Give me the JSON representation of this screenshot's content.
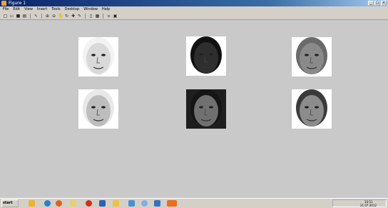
{
  "window": {
    "title": "Figure 1"
  },
  "menu": [
    "File",
    "Edit",
    "View",
    "Insert",
    "Tools",
    "Desktop",
    "Window",
    "Help"
  ],
  "toolbar": [
    "new-figure-icon",
    "open-icon",
    "save-icon",
    "print-icon",
    "pointer-icon",
    "zoom-in-icon",
    "zoom-out-icon",
    "pan-icon",
    "rotate-icon",
    "data-cursor-icon",
    "insert-colorbar-icon",
    "insert-legend-icon",
    "hide-plot-tools-icon",
    "show-plot-tools-icon"
  ],
  "taskbar": {
    "start_label": "start",
    "time": "10:51",
    "date": "21.07.2012"
  },
  "faces": [
    {
      "skin": "#d9d9d9",
      "hair": "#f2f2f2",
      "bg": "#ffffff"
    },
    {
      "skin": "#2e2e2e",
      "hair": "#111111",
      "bg": "#ffffff"
    },
    {
      "skin": "#8a8a8a",
      "hair": "#6a6a6a",
      "bg": "#ffffff"
    },
    {
      "skin": "#bdbdbd",
      "hair": "#e8e8e8",
      "bg": "#ffffff"
    },
    {
      "skin": "#707070",
      "hair": "#151515",
      "bg": "#1e1e1e"
    },
    {
      "skin": "#8c8c8c",
      "hair": "#3a3a3a",
      "bg": "#ffffff"
    }
  ]
}
